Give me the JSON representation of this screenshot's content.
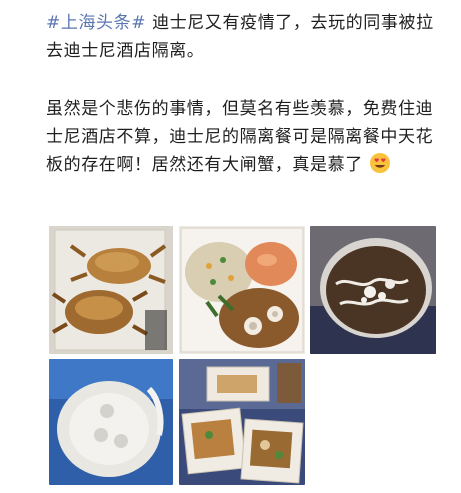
{
  "post": {
    "hashtag": "#上海头条#",
    "line1_rest": " 迪士尼又有疫情了，去玩的同事被拉去迪士尼酒店隔离。",
    "line2": "虽然是个悲伤的事情，但莫名有些羡慕，免费住迪士尼酒店不算，迪士尼的隔离餐可是隔离餐中天花板的存在啊！居然还有大闸蟹，真是慕了",
    "emoji_icon": "heart-eyes-emoji-icon"
  },
  "gallery": {
    "images": [
      {
        "name": "photo-crabs-in-box"
      },
      {
        "name": "photo-rice-and-dishes"
      },
      {
        "name": "photo-dessert-cup"
      },
      {
        "name": "photo-cup-lid"
      },
      {
        "name": "photo-takeout-boxes"
      }
    ]
  },
  "colors": {
    "hashtag": "#5a76b0",
    "text": "#1f1f1f",
    "background": "#ffffff"
  }
}
